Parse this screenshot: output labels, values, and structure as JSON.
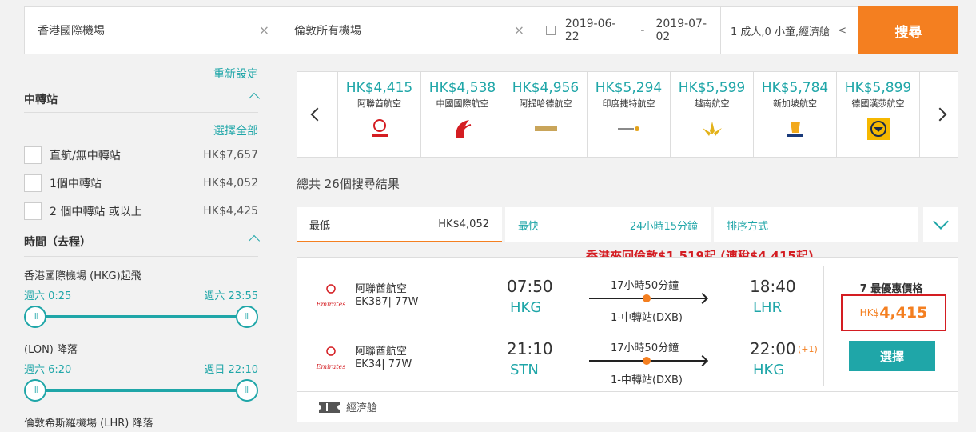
{
  "search": {
    "origin": "香港國際機場",
    "destination": "倫敦所有機場",
    "depart_date": "2019-06-22",
    "date_sep": "-",
    "return_date": "2019-07-02",
    "passengers": "1 成人,0 小童,經濟艙",
    "search_label": "搜尋"
  },
  "sidebar": {
    "reset": "重新設定",
    "stops_title": "中轉站",
    "select_all": "選擇全部",
    "stops": [
      {
        "label": "直航/無中轉站",
        "price": "HK$7,657"
      },
      {
        "label": "1個中轉站",
        "price": "HK$4,052"
      },
      {
        "label": "2 個中轉站 或以上",
        "price": "HK$4,425"
      }
    ],
    "time_title": "時間（去程）",
    "depart_airport": "香港國際機場 (HKG)起飛",
    "depart_from": "週六 0:25",
    "depart_to": "週六 23:55",
    "arrive_airport": "(LON) 降落",
    "arrive_from": "週六 6:20",
    "arrive_to": "週日 22:10",
    "third_airport": "倫敦希斯羅機場 (LHR) 降落"
  },
  "carousel": [
    {
      "price": "HK$4,415",
      "name": "阿聯酋航空",
      "icon": "emirates-logo-icon"
    },
    {
      "price": "HK$4,538",
      "name": "中國國際航空",
      "icon": "air-china-logo-icon"
    },
    {
      "price": "HK$4,956",
      "name": "阿提哈德航空",
      "icon": "etihad-logo-icon"
    },
    {
      "price": "HK$5,294",
      "name": "印度捷特航空",
      "icon": "jet-airways-logo-icon"
    },
    {
      "price": "HK$5,599",
      "name": "越南航空",
      "icon": "vietnam-airlines-logo-icon"
    },
    {
      "price": "HK$5,784",
      "name": "新加坡航空",
      "icon": "singapore-airlines-logo-icon"
    },
    {
      "price": "HK$5,899",
      "name": "德國漢莎航空",
      "icon": "lufthansa-logo-icon"
    }
  ],
  "results": {
    "total": "總共 26個搜尋結果",
    "sort": {
      "cheapest_label": "最低",
      "cheapest_value": "HK$4,052",
      "fastest_label": "最快",
      "fastest_value": "24小時15分鐘",
      "order_label": "排序方式"
    },
    "promo": "香港來回倫敦$1,519起 (連稅$4,415起)",
    "card": {
      "legs": [
        {
          "logo_text": "Emirates",
          "airline": "阿聯酋航空",
          "flight": "EK387| 77W",
          "dep_time": "07:50",
          "dep_code": "HKG",
          "duration": "17小時50分鐘",
          "stops": "1-中轉站(DXB)",
          "arr_time": "18:40",
          "arr_code": "LHR",
          "day_offset": ""
        },
        {
          "logo_text": "Emirates",
          "airline": "阿聯酋航空",
          "flight": "EK34| 77W",
          "dep_time": "21:10",
          "dep_code": "STN",
          "duration": "17小時50分鐘",
          "stops": "1-中轉站(DXB)",
          "arr_time": "22:00",
          "arr_code": "HKG",
          "day_offset": "(+1)"
        }
      ],
      "deal_label": "7 最優惠價格",
      "price_currency": "HK$",
      "price_amount": "4,415",
      "select_label": "選擇",
      "cabin": "經濟艙"
    }
  },
  "colors": {
    "accent": "#1fa6a8",
    "orange": "#f47f20",
    "red": "#d41d22"
  }
}
